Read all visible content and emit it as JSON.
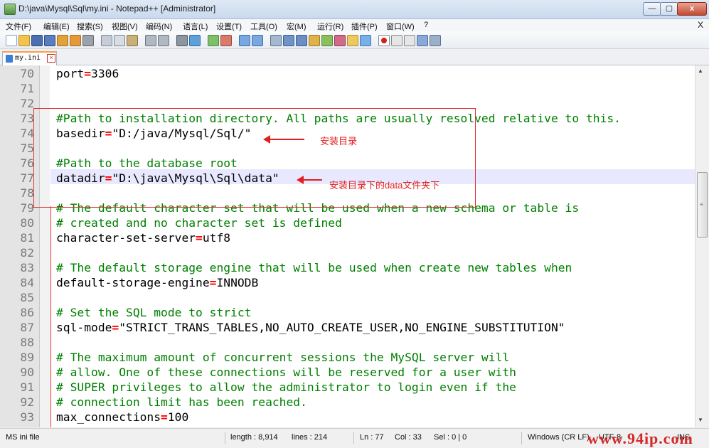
{
  "window": {
    "title": "D:\\java\\Mysql\\Sql\\my.ini - Notepad++ [Administrator]",
    "min_glyph": "—",
    "max_glyph": "▢",
    "close_glyph": "x"
  },
  "menu": {
    "items": [
      "文件(F)",
      "编辑(E)",
      "搜索(S)",
      "视图(V)",
      "编码(N)",
      "语言(L)",
      "设置(T)",
      "工具(O)",
      "宏(M)",
      "运行(R)",
      "插件(P)",
      "窗口(W)",
      "?"
    ],
    "close_glyph": "X"
  },
  "toolbar": {
    "icons": [
      "new-file-icon",
      "open-file-icon",
      "save-icon",
      "save-all-icon",
      "close-icon",
      "close-all-icon",
      "print-icon",
      "cut-icon",
      "copy-icon",
      "paste-icon",
      "undo-icon",
      "redo-icon",
      "find-icon",
      "replace-icon",
      "zoom-in-icon",
      "zoom-out-icon",
      "sync-v-icon",
      "sync-h-icon",
      "word-wrap-icon",
      "show-all-icon",
      "indent-guide-icon",
      "udl-icon",
      "doc-map-icon",
      "function-list-icon",
      "folder-icon",
      "monitor-icon",
      "record-macro-icon",
      "stop-macro-icon",
      "play-macro-icon",
      "run-multiple-icon",
      "save-macro-icon"
    ]
  },
  "tab": {
    "label": "my.ini",
    "close_glyph": "×"
  },
  "editor": {
    "lines": [
      {
        "n": "70",
        "parts": [
          {
            "t": "port",
            "c": "kw"
          },
          {
            "t": "=",
            "c": "eq"
          },
          {
            "t": "3306",
            "c": "str"
          }
        ]
      },
      {
        "n": "71",
        "parts": []
      },
      {
        "n": "72",
        "parts": []
      },
      {
        "n": "73",
        "parts": [
          {
            "t": "#Path to installation directory. All paths are usually resolved relative to this.",
            "c": "comment"
          }
        ]
      },
      {
        "n": "74",
        "parts": [
          {
            "t": "basedir",
            "c": "kw"
          },
          {
            "t": "=",
            "c": "eq"
          },
          {
            "t": "\"D:/java/Mysql/Sql/\"",
            "c": "str"
          }
        ]
      },
      {
        "n": "75",
        "parts": []
      },
      {
        "n": "76",
        "parts": [
          {
            "t": "#Path to the database root",
            "c": "comment"
          }
        ]
      },
      {
        "n": "77",
        "parts": [
          {
            "t": "datadir",
            "c": "kw"
          },
          {
            "t": "=",
            "c": "eq"
          },
          {
            "t": "\"D:\\java\\Mysql\\Sql\\data\"",
            "c": "str"
          }
        ]
      },
      {
        "n": "78",
        "parts": []
      },
      {
        "n": "79",
        "parts": [
          {
            "t": "# The default character set that will be used when a new schema or table is",
            "c": "comment"
          }
        ]
      },
      {
        "n": "80",
        "parts": [
          {
            "t": "# created and no character set is defined",
            "c": "comment"
          }
        ]
      },
      {
        "n": "81",
        "parts": [
          {
            "t": "character-set-server",
            "c": "kw"
          },
          {
            "t": "=",
            "c": "eq"
          },
          {
            "t": "utf8",
            "c": "str"
          }
        ]
      },
      {
        "n": "82",
        "parts": []
      },
      {
        "n": "83",
        "parts": [
          {
            "t": "# The default storage engine that will be used when create new tables when",
            "c": "comment"
          }
        ]
      },
      {
        "n": "84",
        "parts": [
          {
            "t": "default-storage-engine",
            "c": "kw"
          },
          {
            "t": "=",
            "c": "eq"
          },
          {
            "t": "INNODB",
            "c": "str"
          }
        ]
      },
      {
        "n": "85",
        "parts": []
      },
      {
        "n": "86",
        "parts": [
          {
            "t": "# Set the SQL mode to strict",
            "c": "comment"
          }
        ]
      },
      {
        "n": "87",
        "parts": [
          {
            "t": "sql-mode",
            "c": "kw"
          },
          {
            "t": "=",
            "c": "eq"
          },
          {
            "t": "\"STRICT_TRANS_TABLES,NO_AUTO_CREATE_USER,NO_ENGINE_SUBSTITUTION\"",
            "c": "str"
          }
        ]
      },
      {
        "n": "88",
        "parts": []
      },
      {
        "n": "89",
        "parts": [
          {
            "t": "# The maximum amount of concurrent sessions the MySQL server will",
            "c": "comment"
          }
        ]
      },
      {
        "n": "90",
        "parts": [
          {
            "t": "# allow. One of these connections will be reserved for a user with",
            "c": "comment"
          }
        ]
      },
      {
        "n": "91",
        "parts": [
          {
            "t": "# SUPER privileges to allow the administrator to login even if the",
            "c": "comment"
          }
        ]
      },
      {
        "n": "92",
        "parts": [
          {
            "t": "# connection limit has been reached.",
            "c": "comment"
          }
        ]
      },
      {
        "n": "93",
        "parts": [
          {
            "t": "max_connections",
            "c": "kw"
          },
          {
            "t": "=",
            "c": "eq"
          },
          {
            "t": "100",
            "c": "str"
          }
        ]
      }
    ]
  },
  "annotations": {
    "basedir_note": "安装目录",
    "datadir_note": "安装目录下的data文件夹下"
  },
  "status": {
    "file_type": "MS ini file",
    "length": "length : 8,914",
    "lines": "lines : 214",
    "ln": "Ln : 77",
    "col": "Col : 33",
    "sel": "Sel : 0 | 0",
    "eol": "Windows (CR LF)",
    "encoding": "UTF-8",
    "mode": "INS"
  },
  "watermark": "www.94ip.com",
  "colors": {
    "comment": "#008000",
    "operator": "#ff0000",
    "annotation": "#e02020",
    "current_line": "#e8e8ff"
  }
}
